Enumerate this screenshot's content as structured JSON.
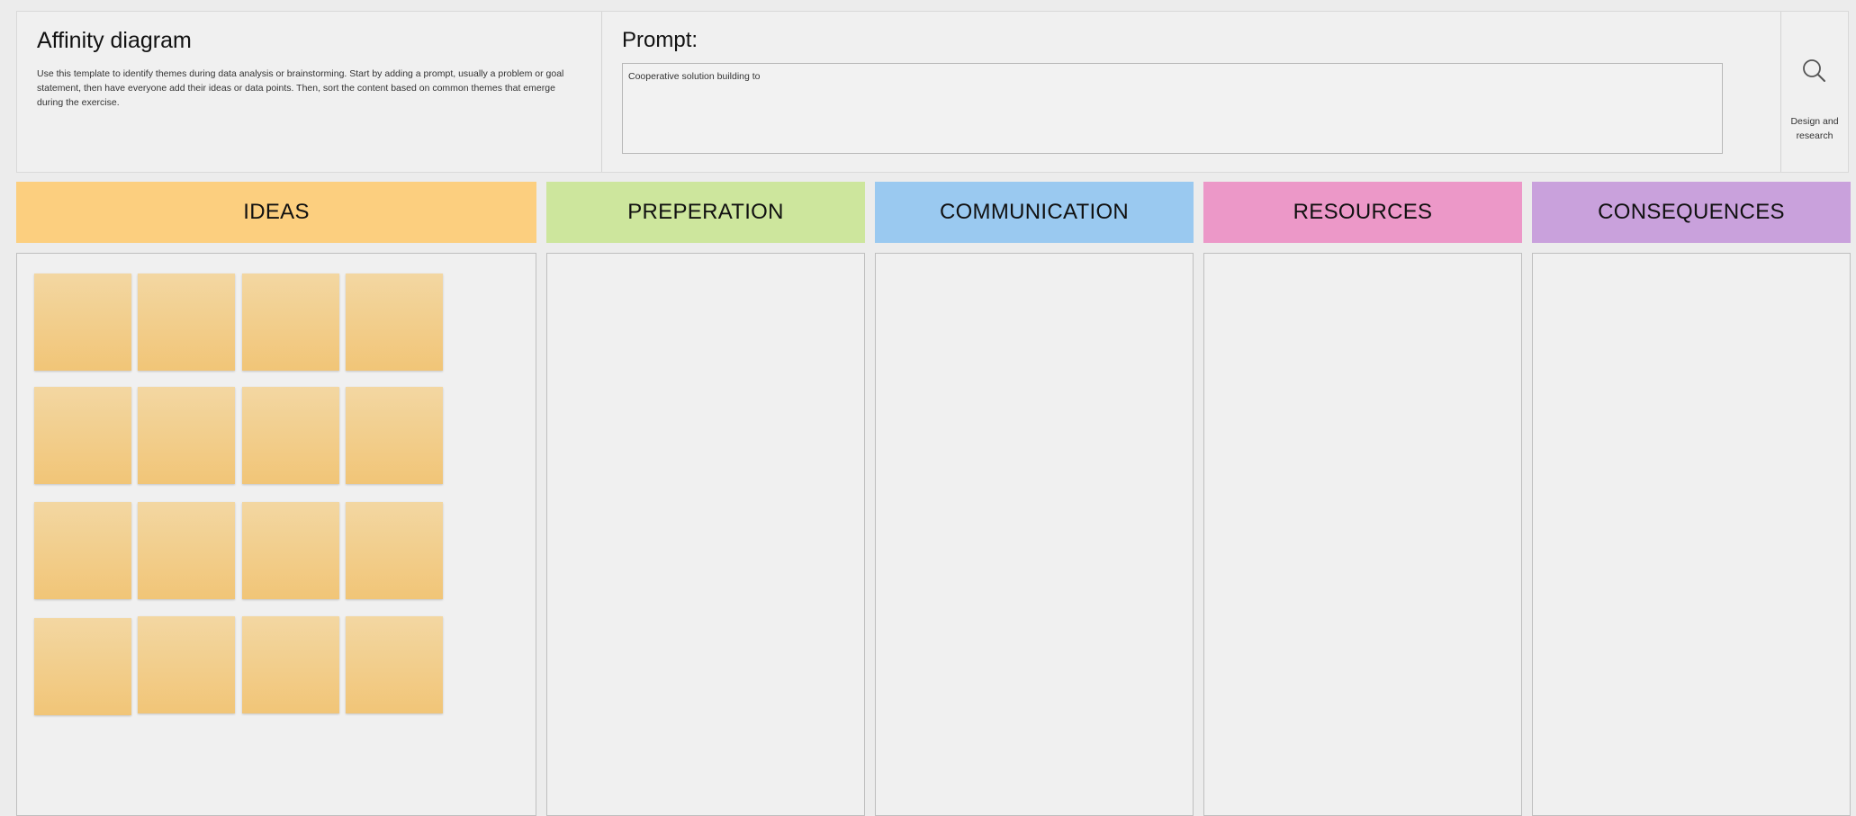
{
  "intro": {
    "title": "Affinity diagram",
    "description": "Use this template to identify themes during data analysis or brainstorming. Start by adding a prompt, usually a problem or goal statement, then have everyone add their ideas or data points. Then, sort the content based on common themes that emerge during the exercise."
  },
  "prompt": {
    "label": "Prompt:",
    "text": "Cooperative solution building to"
  },
  "library": {
    "icon": "search-icon",
    "label": "Design and research"
  },
  "columns": [
    {
      "label": "IDEAS",
      "color": "#fccf7f"
    },
    {
      "label": "PREPERATION",
      "color": "#cde69d"
    },
    {
      "label": "COMMUNICATION",
      "color": "#9ac9f0"
    },
    {
      "label": "RESOURCES",
      "color": "#ec98c8"
    },
    {
      "label": "CONSEQUENCES",
      "color": "#c9a1dc"
    }
  ],
  "sticky_notes": {
    "count": 16,
    "color": "#f1c577"
  }
}
